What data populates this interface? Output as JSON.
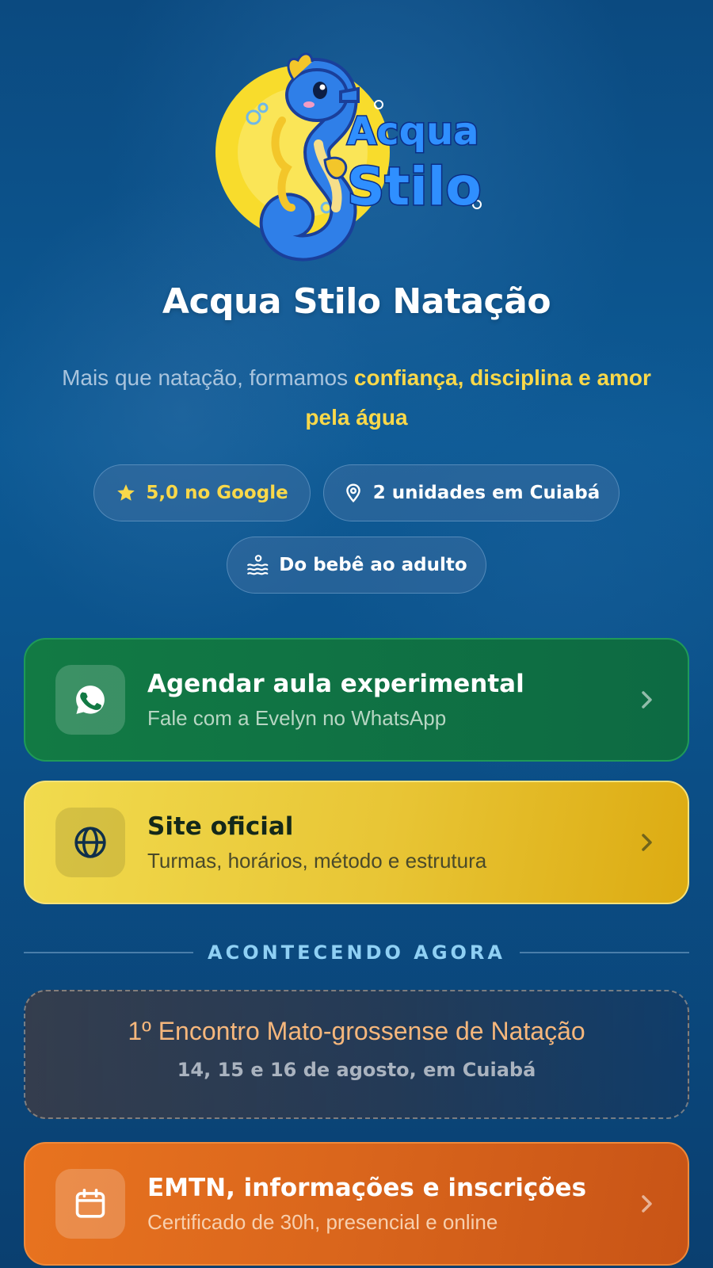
{
  "brand": {
    "logo_line1": "Acqua",
    "logo_line2": "Stilo"
  },
  "header": {
    "title": "Acqua Stilo Natação",
    "tagline_plain": "Mais que natação, formamos ",
    "tagline_highlight": "confiança, disciplina e amor pela água"
  },
  "chips": [
    {
      "label": "5,0 no Google",
      "icon": "star-icon"
    },
    {
      "label": "2 unidades em Cuiabá",
      "icon": "location-pin-icon"
    },
    {
      "label": "Do bebê ao adulto",
      "icon": "swimmer-icon"
    }
  ],
  "links": {
    "whatsapp": {
      "title": "Agendar aula experimental",
      "subtitle": "Fale com a Evelyn no WhatsApp",
      "icon": "whatsapp-icon"
    },
    "site": {
      "title": "Site oficial",
      "subtitle": "Turmas, horários, método e estrutura",
      "icon": "globe-icon"
    },
    "emtn": {
      "title": "EMTN, informações e inscrições",
      "subtitle": "Certificado de 30h, presencial e online",
      "icon": "calendar-icon"
    }
  },
  "section": {
    "label": "ACONTECENDO AGORA"
  },
  "event": {
    "title": "1º Encontro Mato-grossense de Natação",
    "date": "14, 15 e 16 de agosto, em Cuiabá"
  },
  "colors": {
    "accent_yellow": "#f9d84a",
    "whatsapp_green": "#127a44",
    "site_yellow": "#e8c535",
    "emtn_orange": "#e8731f",
    "event_text": "#f6b77c",
    "section_label": "#8fd0f4"
  }
}
